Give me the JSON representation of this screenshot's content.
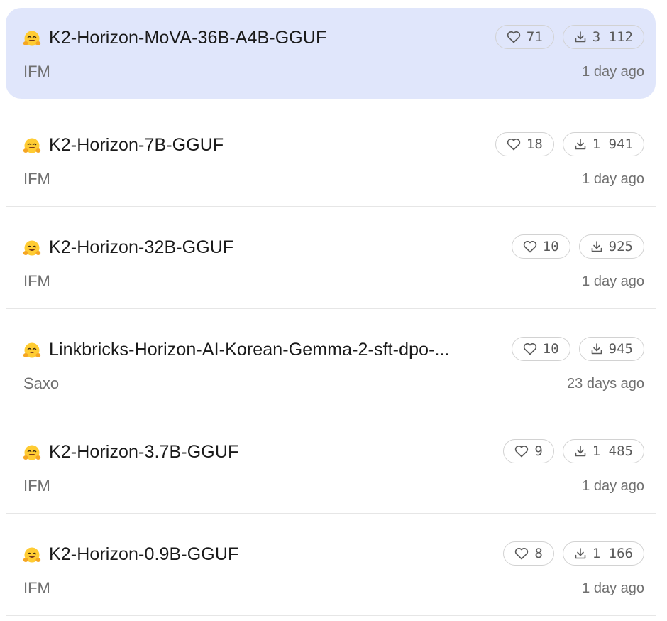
{
  "models": [
    {
      "name": "K2-Horizon-MoVA-36B-A4B-GGUF",
      "author": "IFM",
      "updated": "1 day ago",
      "likes": "71",
      "downloads": "3 112",
      "selected": true,
      "icon": "hugging-face-emoji-icon"
    },
    {
      "name": "K2-Horizon-7B-GGUF",
      "author": "IFM",
      "updated": "1 day ago",
      "likes": "18",
      "downloads": "1 941",
      "selected": false,
      "icon": "hugging-face-emoji-icon"
    },
    {
      "name": "K2-Horizon-32B-GGUF",
      "author": "IFM",
      "updated": "1 day ago",
      "likes": "10",
      "downloads": "925",
      "selected": false,
      "icon": "hugging-face-emoji-icon"
    },
    {
      "name": "Linkbricks-Horizon-AI-Korean-Gemma-2-sft-dpo-...",
      "author": "Saxo",
      "updated": "23 days ago",
      "likes": "10",
      "downloads": "945",
      "selected": false,
      "icon": "hugging-face-emoji-icon"
    },
    {
      "name": "K2-Horizon-3.7B-GGUF",
      "author": "IFM",
      "updated": "1 day ago",
      "likes": "9",
      "downloads": "1 485",
      "selected": false,
      "icon": "hugging-face-emoji-icon"
    },
    {
      "name": "K2-Horizon-0.9B-GGUF",
      "author": "IFM",
      "updated": "1 day ago",
      "likes": "8",
      "downloads": "1 166",
      "selected": false,
      "icon": "hugging-face-emoji-icon"
    }
  ],
  "colors": {
    "selected_background": "#e0e6fb",
    "emoji_face": "#ffcc33",
    "text_primary": "#1a1a1a",
    "text_secondary": "#707070"
  }
}
